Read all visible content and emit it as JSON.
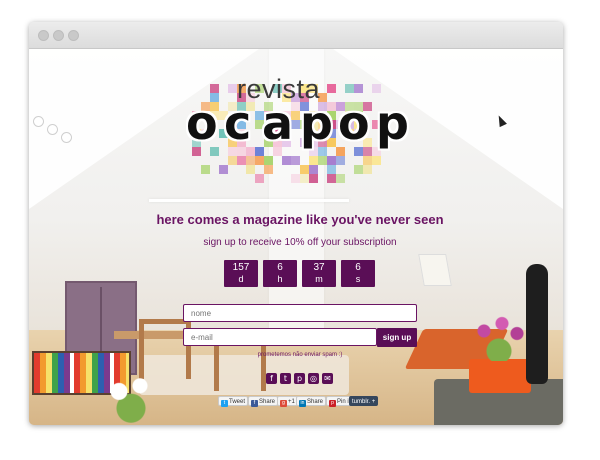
{
  "logo": {
    "top_word": "revista",
    "main_word": "ocapop",
    "mosaic_colors": [
      "#f6d0df",
      "#f3a7c6",
      "#e7679b",
      "#c73a7a",
      "#f5a25a",
      "#f7c75c",
      "#fbe58a",
      "#a7d36a",
      "#6cc1b5",
      "#5aa6df",
      "#6b7fd6",
      "#9a6bc9",
      "#c79ad9",
      "#e4c3e8",
      "#f1e6a2"
    ]
  },
  "headline": {
    "tagline": "here comes a magazine like you've never seen",
    "subline": "sign up to receive 10% off your subscription"
  },
  "countdown": [
    {
      "value": "157",
      "unit": "d"
    },
    {
      "value": "6",
      "unit": "h"
    },
    {
      "value": "37",
      "unit": "m"
    },
    {
      "value": "6",
      "unit": "s"
    }
  ],
  "form": {
    "name_placeholder": "nome",
    "email_placeholder": "e-mail",
    "submit_label": "sign up",
    "spam_note": "prometemos não enviar spam :)"
  },
  "social_icons": [
    {
      "name": "facebook-icon",
      "glyph": "f"
    },
    {
      "name": "twitter-icon",
      "glyph": "t"
    },
    {
      "name": "pinterest-icon",
      "glyph": "p"
    },
    {
      "name": "instagram-icon",
      "glyph": "◎"
    },
    {
      "name": "email-icon",
      "glyph": "✉"
    }
  ],
  "share_buttons": [
    {
      "name": "tweet-button",
      "label": "Tweet",
      "color": "#1da1f2",
      "glyph": "t"
    },
    {
      "name": "facebook-share-button",
      "label": "Share",
      "color": "#3b5998",
      "glyph": "f"
    },
    {
      "name": "google-plus-button",
      "label": "+1",
      "color": "#dd4b39",
      "glyph": "g"
    },
    {
      "name": "linkedin-share-button",
      "label": "Share",
      "color": "#0077b5",
      "glyph": "in"
    },
    {
      "name": "pinterest-pin-button",
      "label": "Pin it",
      "color": "#cb2027",
      "glyph": "p"
    },
    {
      "name": "tumblr-button",
      "label": "tumblr.",
      "color": "#35465c",
      "glyph": "+"
    }
  ],
  "colors": {
    "brand_purple": "#5a0e56",
    "text_purple": "#6a1463"
  }
}
